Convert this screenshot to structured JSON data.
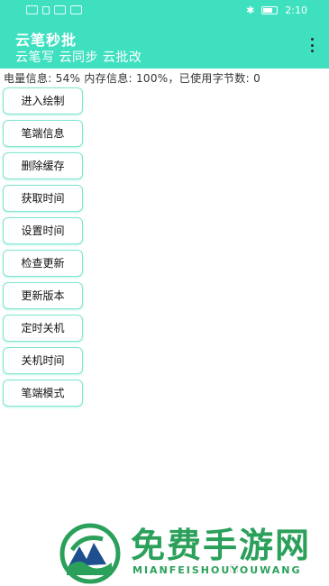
{
  "status_bar": {
    "time": "2:10",
    "bluetooth_icon": "bluetooth-icon",
    "battery_icon": "battery-icon"
  },
  "app_bar": {
    "title": "云笔秒批",
    "subtitle": "云笔写 云同步 云批改",
    "menu_icon": "more-vert-icon"
  },
  "info_line": "电量信息: 54%  内存信息: 100%，已使用字节数: 0",
  "buttons": [
    {
      "label": "进入绘制"
    },
    {
      "label": "笔端信息"
    },
    {
      "label": "删除缓存"
    },
    {
      "label": "获取时间"
    },
    {
      "label": "设置时间"
    },
    {
      "label": "检查更新"
    },
    {
      "label": "更新版本"
    },
    {
      "label": "定时关机"
    },
    {
      "label": "关机时间"
    },
    {
      "label": "笔端模式"
    }
  ],
  "watermark": {
    "text": "免费手游网",
    "sub": "MIANFEISHOUYOUWANG"
  },
  "colors": {
    "accent": "#3fe0c0",
    "button_border": "#7fe4cf",
    "watermark": "#2ba05a"
  }
}
